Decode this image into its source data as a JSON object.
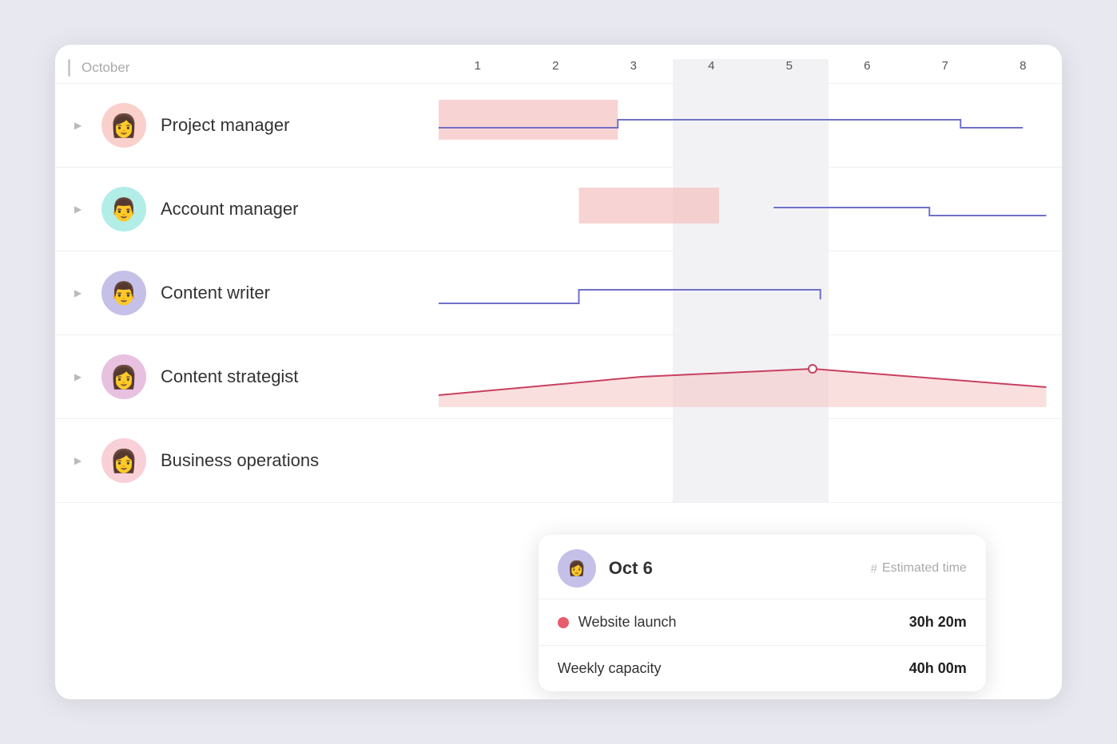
{
  "month": "October",
  "days": [
    "1",
    "2",
    "3",
    "4",
    "5",
    "6",
    "7",
    "8"
  ],
  "highlight_cols": [
    3,
    4
  ],
  "roles": [
    {
      "id": "pm",
      "name": "Project manager",
      "avatar_class": "pm face-pm",
      "avatar_emoji": "👩"
    },
    {
      "id": "am",
      "name": "Account manager",
      "avatar_class": "am face-am",
      "avatar_emoji": "👨"
    },
    {
      "id": "cw",
      "name": "Content writer",
      "avatar_class": "cw face-cw",
      "avatar_emoji": "👨"
    },
    {
      "id": "cs",
      "name": "Content strategist",
      "avatar_class": "cs face-cs",
      "avatar_emoji": "👩"
    },
    {
      "id": "bo",
      "name": "Business operations",
      "avatar_class": "bo face-bo",
      "avatar_emoji": "👩"
    }
  ],
  "tooltip": {
    "date": "Oct 6",
    "col_label": "Estimated time",
    "avatar_emoji": "👩",
    "rows": [
      {
        "label": "Website launch",
        "value": "30h 20m",
        "dot_class": "red"
      },
      {
        "label": "Weekly capacity",
        "value": "40h 00m",
        "dot_class": ""
      }
    ]
  }
}
